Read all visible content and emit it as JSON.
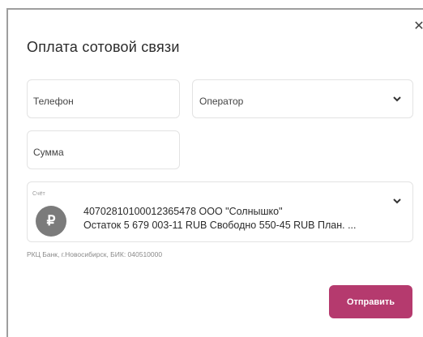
{
  "dialog": {
    "title": "Оплата сотовой связи",
    "close_icon": "close-icon"
  },
  "form": {
    "phone": {
      "placeholder": "Телефон"
    },
    "operator": {
      "placeholder": "Оператор",
      "chevron_icon": "chevron-down-icon"
    },
    "amount": {
      "placeholder": "Сумма"
    },
    "account": {
      "label": "Счёт",
      "avatar_glyph": "₽",
      "line1": "40702810100012365478 ООО \"Солнышко\"",
      "line2": "Остаток 5 679 003-11 RUB Свободно 550-45 RUB  План. ...",
      "chevron_icon": "chevron-down-icon"
    },
    "bank_info": "РКЦ Банк, г.Новосибирск, БИК: 040510000"
  },
  "actions": {
    "submit_label": "Отправить",
    "submit_color": "#b53a6e"
  }
}
